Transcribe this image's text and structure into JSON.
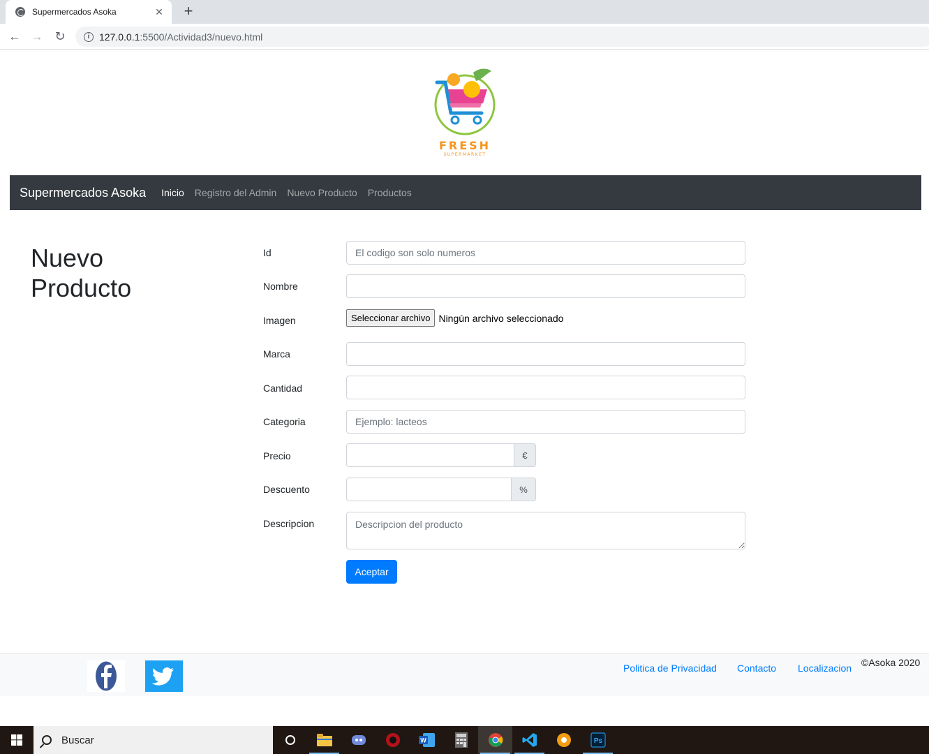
{
  "browser": {
    "tab_title": "Supermercados Asoka",
    "tab_close": "✕",
    "new_tab": "+",
    "back": "←",
    "forward": "→",
    "reload": "↻",
    "url_host": "127.0.0.1",
    "url_path": ":5500/Actividad3/nuevo.html"
  },
  "logo": {
    "text": "FRESH",
    "subtext": "SUPERMARKET"
  },
  "navbar": {
    "brand": "Supermercados Asoka",
    "links": [
      "Inicio",
      "Registro del Admin",
      "Nuevo Producto",
      "Productos"
    ]
  },
  "page": {
    "title_line1": "Nuevo",
    "title_line2": "Producto"
  },
  "form": {
    "id_label": "Id",
    "id_placeholder": "El codigo son solo numeros",
    "nombre_label": "Nombre",
    "imagen_label": "Imagen",
    "file_button": "Seleccionar archivo",
    "file_status": "Ningún archivo seleccionado",
    "marca_label": "Marca",
    "cantidad_label": "Cantidad",
    "categoria_label": "Categoria",
    "categoria_placeholder": "Ejemplo: lacteos",
    "precio_label": "Precio",
    "precio_addon": "€",
    "descuento_label": "Descuento",
    "descuento_addon": "%",
    "descripcion_label": "Descripcion",
    "descripcion_placeholder": "Descripcion del producto",
    "submit": "Aceptar"
  },
  "footer": {
    "links": [
      "Politica de Privacidad",
      "Contacto",
      "Localizacion"
    ],
    "copyright": "©Asoka 2020"
  },
  "taskbar": {
    "search_label": "Buscar"
  },
  "colors": {
    "navbar_bg": "#343a40",
    "primary": "#007bff",
    "footer_bg": "#f8f9fa"
  }
}
